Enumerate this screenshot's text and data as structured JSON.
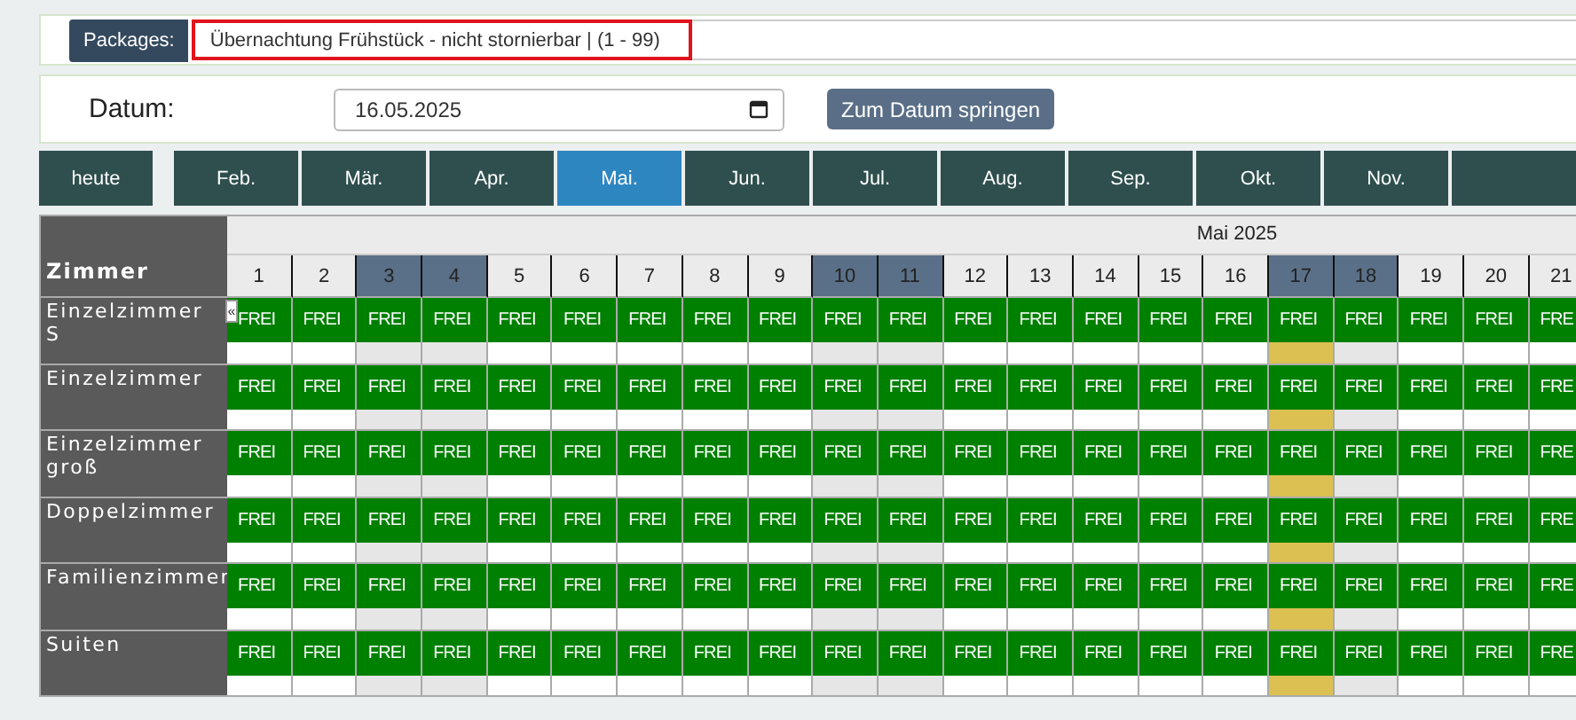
{
  "packages": {
    "label": "Packages:",
    "value": "Übernachtung Frühstück - nicht stornierbar | (1 - 99)"
  },
  "date_bar": {
    "label": "Datum:",
    "value": "16.05.2025",
    "jump_button": "Zum Datum springen"
  },
  "today_button": "heute",
  "months": [
    {
      "label": "Feb.",
      "selected": false
    },
    {
      "label": "Mär.",
      "selected": false
    },
    {
      "label": "Apr.",
      "selected": false
    },
    {
      "label": "Mai.",
      "selected": true
    },
    {
      "label": "Jun.",
      "selected": false
    },
    {
      "label": "Jul.",
      "selected": false
    },
    {
      "label": "Aug.",
      "selected": false
    },
    {
      "label": "Sep.",
      "selected": false
    },
    {
      "label": "Okt.",
      "selected": false
    },
    {
      "label": "Nov.",
      "selected": false
    },
    {
      "selected": false
    }
  ],
  "calendar": {
    "corner_label": "Zimmer",
    "month_title": "Mai 2025",
    "back_button": "«",
    "days": [
      {
        "label": "1",
        "weekend": false,
        "selected": false
      },
      {
        "label": "2",
        "weekend": false,
        "selected": false
      },
      {
        "label": "3",
        "weekend": true,
        "selected": false
      },
      {
        "label": "4",
        "weekend": true,
        "selected": false
      },
      {
        "label": "5",
        "weekend": false,
        "selected": false
      },
      {
        "label": "6",
        "weekend": false,
        "selected": false
      },
      {
        "label": "7",
        "weekend": false,
        "selected": false
      },
      {
        "label": "8",
        "weekend": false,
        "selected": false
      },
      {
        "label": "9",
        "weekend": false,
        "selected": false
      },
      {
        "label": "10",
        "weekend": true,
        "selected": false
      },
      {
        "label": "11",
        "weekend": true,
        "selected": false
      },
      {
        "label": "12",
        "weekend": false,
        "selected": false
      },
      {
        "label": "13",
        "weekend": false,
        "selected": false
      },
      {
        "label": "14",
        "weekend": false,
        "selected": false
      },
      {
        "label": "15",
        "weekend": false,
        "selected": false
      },
      {
        "label": "16",
        "weekend": false,
        "selected": false
      },
      {
        "label": "17",
        "weekend": true,
        "selected": true
      },
      {
        "label": "18",
        "weekend": true,
        "selected": false
      },
      {
        "label": "19",
        "weekend": false,
        "selected": false
      },
      {
        "label": "20",
        "weekend": false,
        "selected": false
      },
      {
        "label": "21",
        "weekend": false,
        "selected": false
      }
    ],
    "rooms": [
      {
        "name": "Einzelzimmer S",
        "cells": [
          "FREI",
          "FREI",
          "FREI",
          "FREI",
          "FREI",
          "FREI",
          "FREI",
          "FREI",
          "FREI",
          "FREI",
          "FREI",
          "FREI",
          "FREI",
          "FREI",
          "FREI",
          "FREI",
          "FREI",
          "FREI",
          "FREI",
          "FREI",
          "FRE"
        ]
      },
      {
        "name": "Einzelzimmer",
        "cells": [
          "FREI",
          "FREI",
          "FREI",
          "FREI",
          "FREI",
          "FREI",
          "FREI",
          "FREI",
          "FREI",
          "FREI",
          "FREI",
          "FREI",
          "FREI",
          "FREI",
          "FREI",
          "FREI",
          "FREI",
          "FREI",
          "FREI",
          "FREI",
          "FRE"
        ]
      },
      {
        "name": "Einzelzimmer groß",
        "cells": [
          "FREI",
          "FREI",
          "FREI",
          "FREI",
          "FREI",
          "FREI",
          "FREI",
          "FREI",
          "FREI",
          "FREI",
          "FREI",
          "FREI",
          "FREI",
          "FREI",
          "FREI",
          "FREI",
          "FREI",
          "FREI",
          "FREI",
          "FREI",
          "FRE"
        ]
      },
      {
        "name": "Doppelzimmer",
        "cells": [
          "FREI",
          "FREI",
          "FREI",
          "FREI",
          "FREI",
          "FREI",
          "FREI",
          "FREI",
          "FREI",
          "FREI",
          "FREI",
          "FREI",
          "FREI",
          "FREI",
          "FREI",
          "FREI",
          "FREI",
          "FREI",
          "FREI",
          "FREI",
          "FRE"
        ]
      },
      {
        "name": "Familienzimmer",
        "cells": [
          "FREI",
          "FREI",
          "FREI",
          "FREI",
          "FREI",
          "FREI",
          "FREI",
          "FREI",
          "FREI",
          "FREI",
          "FREI",
          "FREI",
          "FREI",
          "FREI",
          "FREI",
          "FREI",
          "FREI",
          "FREI",
          "FREI",
          "FREI",
          "FRE"
        ]
      },
      {
        "name": "Suiten",
        "cells": [
          "FREI",
          "FREI",
          "FREI",
          "FREI",
          "FREI",
          "FREI",
          "FREI",
          "FREI",
          "FREI",
          "FREI",
          "FREI",
          "FREI",
          "FREI",
          "FREI",
          "FREI",
          "FREI",
          "FREI",
          "FREI",
          "FREI",
          "FREI",
          "FRE"
        ]
      }
    ]
  }
}
